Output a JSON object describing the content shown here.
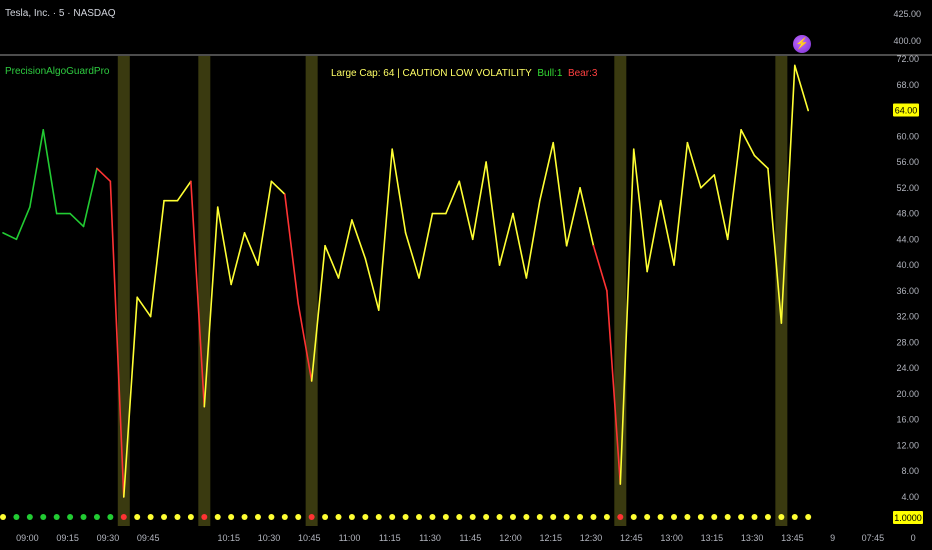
{
  "header": {
    "title": "Tesla, Inc. · 5 · NASDAQ",
    "indicator_name": "PrecisionAlgoGuardPro"
  },
  "status": {
    "label": "Large Cap: 64 | CAUTION  LOW VOLATILITY",
    "bull": "Bull:1",
    "bear": "Bear:3"
  },
  "logo": {
    "glyph": "⚡",
    "icon": "lightning-logo-icon"
  },
  "colors": {
    "bull": "#22cc33",
    "neutral": "#ffff33",
    "bear": "#ff3333",
    "highlight": "#3a3a10",
    "price_badge": "#ffff00"
  },
  "chart_data": {
    "type": "line",
    "title": "",
    "xlabel": "",
    "ylabel": "",
    "ylim": [
      0,
      74
    ],
    "price_axis_ticks": [
      "425.00",
      "400.00"
    ],
    "y_ticks": [
      72,
      68,
      64,
      60,
      56,
      52,
      48,
      44,
      40,
      36,
      32,
      28,
      24,
      20,
      16,
      12,
      8,
      4
    ],
    "current_value": "64.00",
    "baseline_value": "1.0000",
    "x_tick_labels": [
      "09:00",
      "09:15",
      "09:30",
      "09:45",
      "10:15",
      "10:30",
      "10:45",
      "11:00",
      "11:15",
      "11:30",
      "11:45",
      "12:00",
      "12:15",
      "12:30",
      "12:45",
      "13:00",
      "13:15",
      "13:30",
      "13:45",
      "9",
      "07:45",
      "0"
    ],
    "x_tick_bars": [
      1,
      4,
      7,
      10,
      16,
      19,
      22,
      25,
      28,
      31,
      34,
      37,
      40,
      43,
      46,
      49,
      52,
      55,
      58,
      61,
      64,
      67
    ],
    "series": [
      {
        "values": [
          45,
          44,
          49,
          61,
          48,
          48,
          46,
          55,
          53,
          4,
          35,
          32,
          50,
          50,
          53,
          18,
          49,
          37,
          45,
          40,
          53,
          51,
          34,
          22,
          43,
          38,
          47,
          41,
          33,
          58,
          45,
          38,
          48,
          48,
          53,
          44,
          56,
          40,
          48,
          38,
          50,
          59,
          43,
          52,
          43,
          36,
          6,
          58,
          39,
          50,
          40,
          59,
          52,
          54,
          44,
          61,
          57,
          55,
          31,
          71,
          64
        ],
        "state": [
          "bull",
          "bull",
          "bull",
          "bull",
          "bull",
          "bull",
          "bull",
          "bull",
          "bear",
          "bear",
          "neutral",
          "neutral",
          "neutral",
          "neutral",
          "neutral",
          "bear",
          "neutral",
          "neutral",
          "neutral",
          "neutral",
          "neutral",
          "neutral",
          "bear",
          "bear",
          "neutral",
          "neutral",
          "neutral",
          "neutral",
          "neutral",
          "neutral",
          "neutral",
          "neutral",
          "neutral",
          "neutral",
          "neutral",
          "neutral",
          "neutral",
          "neutral",
          "neutral",
          "neutral",
          "neutral",
          "neutral",
          "neutral",
          "neutral",
          "neutral",
          "bear",
          "bear",
          "neutral",
          "neutral",
          "neutral",
          "neutral",
          "neutral",
          "neutral",
          "neutral",
          "neutral",
          "neutral",
          "neutral",
          "neutral",
          "neutral",
          "neutral",
          "neutral"
        ]
      }
    ],
    "highlight_bars": [
      9,
      15,
      23,
      46,
      58
    ],
    "dots": [
      "neutral",
      "bull",
      "bull",
      "bull",
      "bull",
      "bull",
      "bull",
      "bull",
      "bull",
      "bear",
      "neutral",
      "neutral",
      "neutral",
      "neutral",
      "neutral",
      "bear",
      "neutral",
      "neutral",
      "neutral",
      "neutral",
      "neutral",
      "neutral",
      "neutral",
      "bear",
      "neutral",
      "neutral",
      "neutral",
      "neutral",
      "neutral",
      "neutral",
      "neutral",
      "neutral",
      "neutral",
      "neutral",
      "neutral",
      "neutral",
      "neutral",
      "neutral",
      "neutral",
      "neutral",
      "neutral",
      "neutral",
      "neutral",
      "neutral",
      "neutral",
      "neutral",
      "bear",
      "neutral",
      "neutral",
      "neutral",
      "neutral",
      "neutral",
      "neutral",
      "neutral",
      "neutral",
      "neutral",
      "neutral",
      "neutral",
      "neutral",
      "neutral",
      "neutral"
    ]
  }
}
